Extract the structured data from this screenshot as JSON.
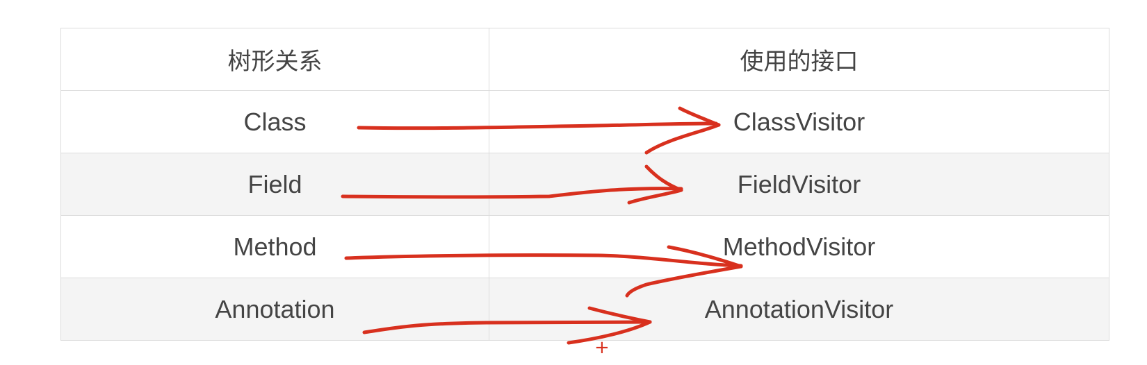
{
  "table": {
    "headers": [
      "树形关系",
      "使用的接口"
    ],
    "rows": [
      [
        "Class",
        "ClassVisitor"
      ],
      [
        "Field",
        "FieldVisitor"
      ],
      [
        "Method",
        "MethodVisitor"
      ],
      [
        "Annotation",
        "AnnotationVisitor"
      ]
    ]
  },
  "annotations": {
    "color": "#d8301e",
    "mark_icon": "hand-drawn-arrow-icon",
    "plus_mark": "+"
  }
}
